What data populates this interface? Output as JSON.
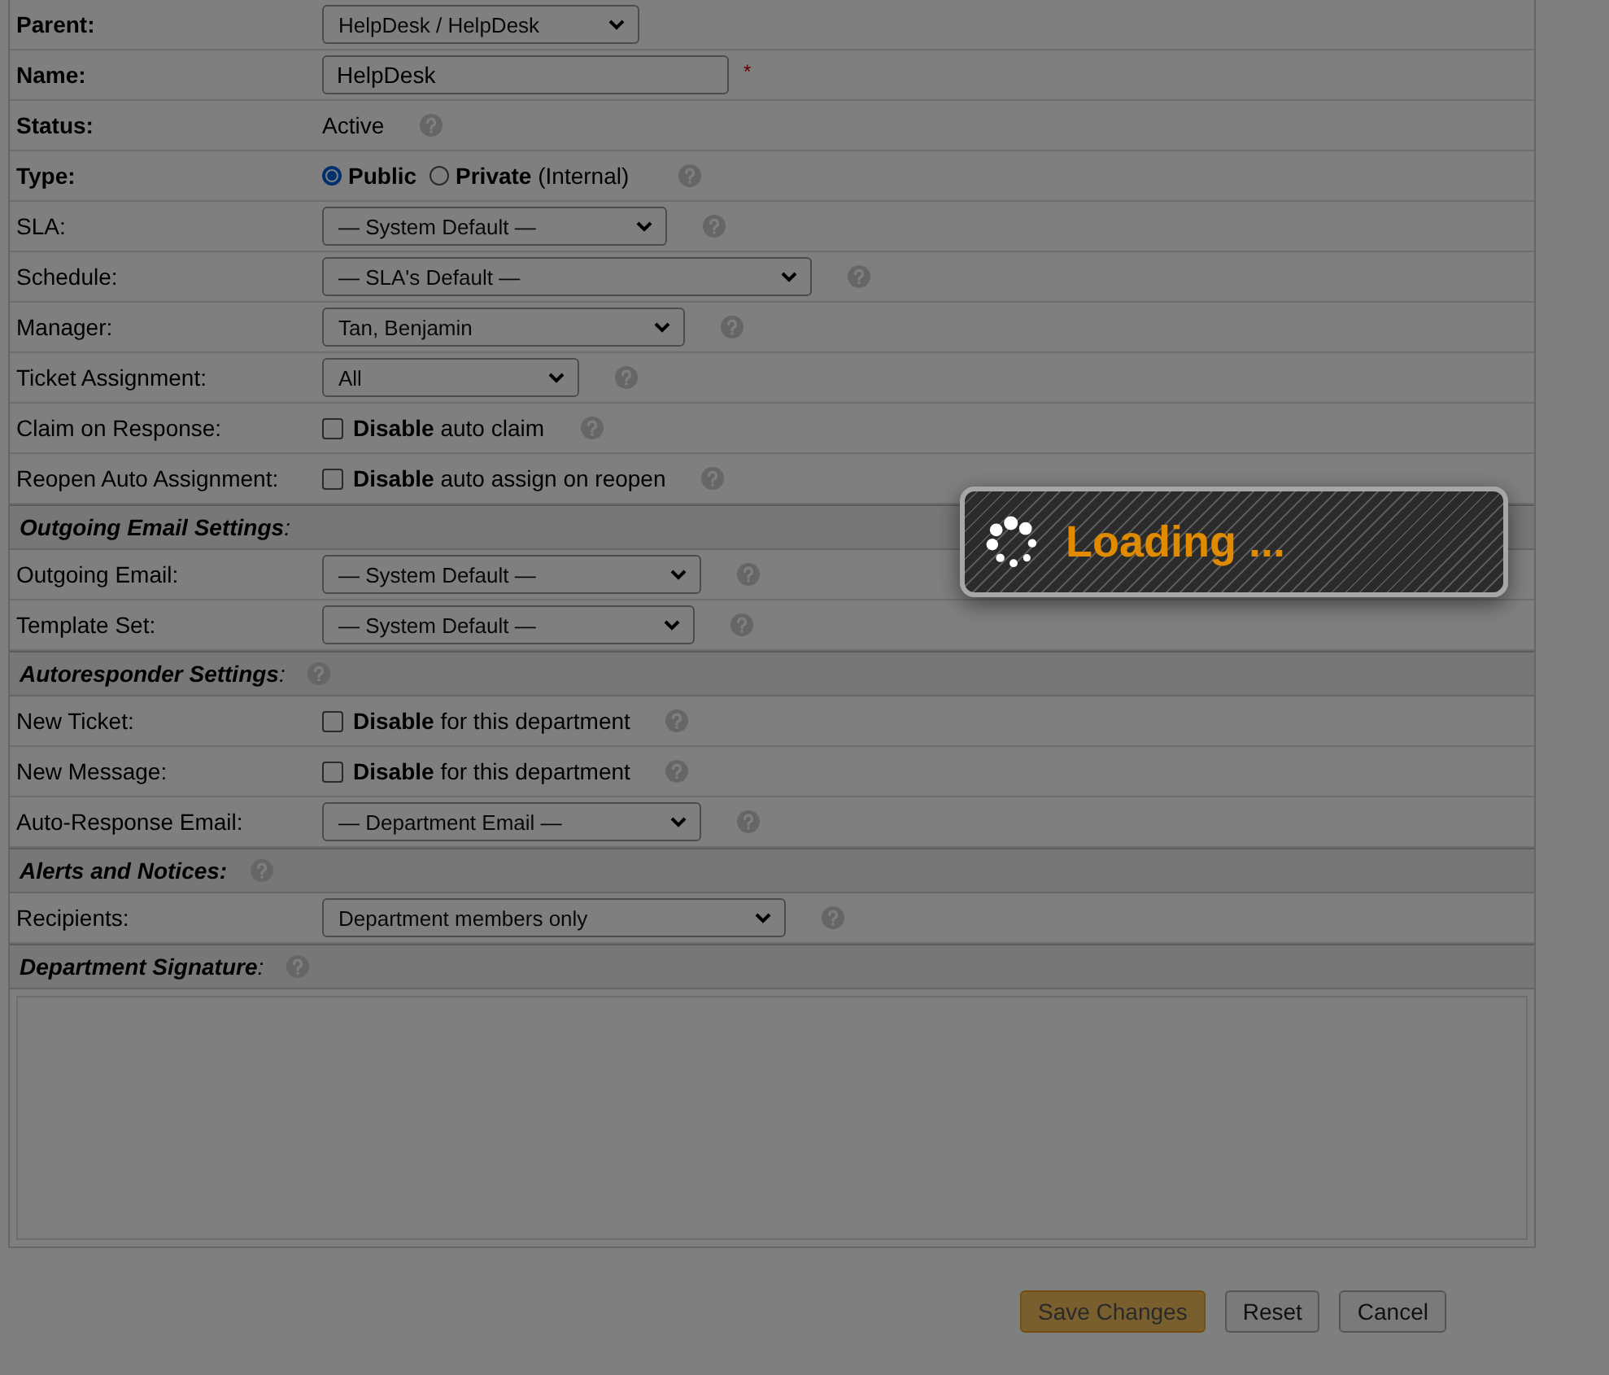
{
  "form": {
    "rows": [
      {
        "kind": "select",
        "label": "Parent:",
        "bold": true,
        "value": "HelpDesk / HelpDesk",
        "help": false
      },
      {
        "kind": "text",
        "label": "Name:",
        "bold": true,
        "value": "HelpDesk",
        "required_mark": "*",
        "help": false
      },
      {
        "kind": "static",
        "label": "Status:",
        "bold": true,
        "value": "Active",
        "help": true
      },
      {
        "kind": "radio",
        "label": "Type:",
        "bold": true,
        "options": [
          {
            "label": "Public",
            "selected": true
          },
          {
            "label": "Private",
            "note": "(Internal)",
            "selected": false
          }
        ],
        "help": true
      },
      {
        "kind": "select",
        "label": "SLA:",
        "bold": false,
        "value": "— System Default —",
        "help": true
      },
      {
        "kind": "select",
        "label": "Schedule:",
        "bold": false,
        "value": "— SLA's Default —",
        "help": true
      },
      {
        "kind": "select",
        "label": "Manager:",
        "bold": false,
        "value": "Tan, Benjamin",
        "help": true
      },
      {
        "kind": "select",
        "label": "Ticket Assignment:",
        "bold": false,
        "value": "All",
        "help": true
      },
      {
        "kind": "checkbox",
        "label": "Claim on Response:",
        "bold": false,
        "text": "**Disable** auto claim",
        "checked": false,
        "help": true
      },
      {
        "kind": "checkbox",
        "label": "Reopen Auto Assignment:",
        "bold": false,
        "text": "**Disable** auto assign on reopen",
        "checked": false,
        "help": true
      },
      {
        "kind": "section",
        "label": "**Outgoing Email Settings**:",
        "help": false
      },
      {
        "kind": "select",
        "label": "Outgoing Email:",
        "bold": false,
        "value": "— System Default —",
        "help": true
      },
      {
        "kind": "select",
        "label": "Template Set:",
        "bold": false,
        "value": "— System Default —",
        "help": true
      },
      {
        "kind": "section",
        "label": "**Autoresponder Settings**:",
        "help": true
      },
      {
        "kind": "checkbox",
        "label": "New Ticket:",
        "bold": false,
        "text": "**Disable** for this department",
        "checked": false,
        "help": true
      },
      {
        "kind": "checkbox",
        "label": "New Message:",
        "bold": false,
        "text": "**Disable** for this department",
        "checked": false,
        "help": true
      },
      {
        "kind": "select",
        "label": "Auto-Response Email:",
        "bold": false,
        "value": "— Department Email —",
        "help": true
      },
      {
        "kind": "section",
        "label": "**Alerts and Notices:**",
        "help": true
      },
      {
        "kind": "select",
        "label": "Recipients:",
        "bold": false,
        "value": "Department members only",
        "help": true
      },
      {
        "kind": "section",
        "label": "**Department Signature**:",
        "help": true
      },
      {
        "kind": "textarea",
        "help": false
      }
    ]
  },
  "buttons": [
    {
      "label": "Save Changes",
      "kind": "primary"
    },
    {
      "label": "Reset",
      "kind": "default"
    },
    {
      "label": "Cancel",
      "kind": "default"
    }
  ],
  "loading": {
    "text": "Loading ..."
  }
}
